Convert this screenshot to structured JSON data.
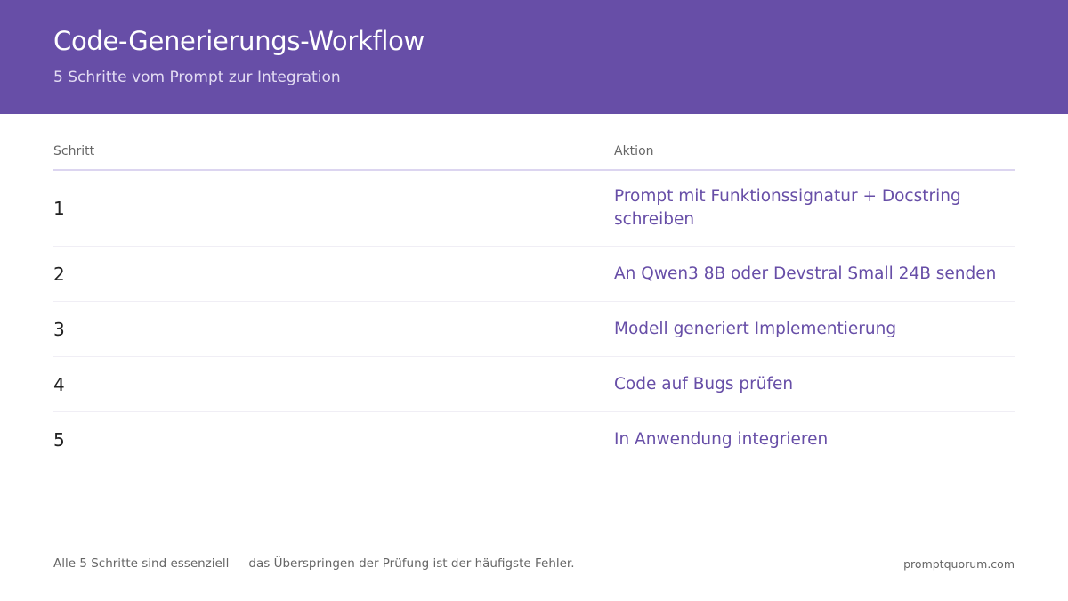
{
  "header": {
    "title": "Code-Generierungs-Workflow",
    "subtitle": "5 Schritte vom Prompt zur Integration"
  },
  "table": {
    "columns": [
      "Schritt",
      "Aktion"
    ],
    "rows": [
      {
        "step": "1",
        "action": "Prompt mit Funktionssignatur + Docstring schreiben"
      },
      {
        "step": "2",
        "action": "An Qwen3 8B oder Devstral Small 24B senden"
      },
      {
        "step": "3",
        "action": "Modell generiert Implementierung"
      },
      {
        "step": "4",
        "action": "Code auf Bugs prüfen"
      },
      {
        "step": "5",
        "action": "In Anwendung integrieren"
      }
    ]
  },
  "footer": {
    "note": "Alle 5 Schritte sind essenziell — das Überspringen der Prüfung ist der häufigste Fehler.",
    "brand": "promptquorum.com"
  },
  "colors": {
    "header_bg": "#674ea7",
    "accent": "#674ea7",
    "text": "#222222",
    "muted": "#666666"
  }
}
